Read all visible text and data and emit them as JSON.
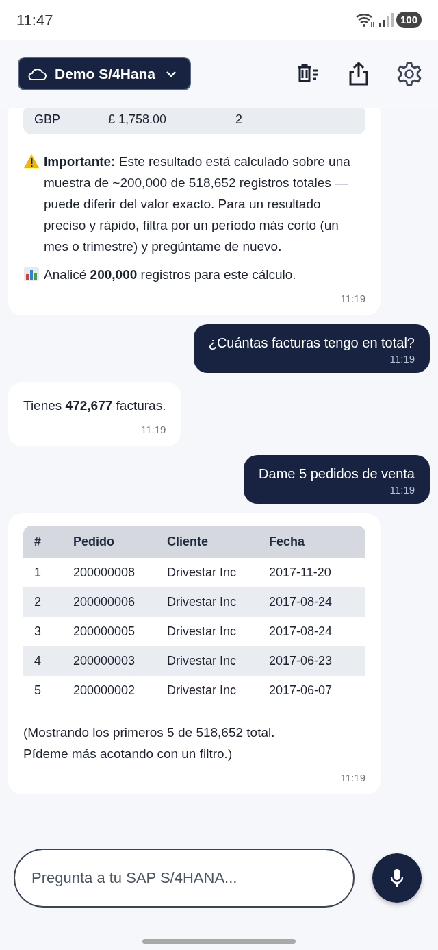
{
  "status_bar": {
    "time": "11:47",
    "battery": "100"
  },
  "header": {
    "workspace": "Demo S/4Hana"
  },
  "messages": [
    {
      "kind": "bot",
      "table_tail": [
        [
          "GBP",
          "£ 1,758.00",
          "2"
        ]
      ],
      "paragraphs": [
        {
          "kind": "warning",
          "text": "**Importante:** Este resultado está calculado sobre una muestra de ~200,000 de 518,652 registros totales — puede diferir del valor exacto. Para un resultado preciso y rápido, filtra por un período más corto (un mes o trimestre) y pregúntame de nuevo."
        },
        {
          "kind": "stats",
          "text": "Analicé **200,000** registros para este cálculo."
        }
      ],
      "time": "11:19"
    },
    {
      "kind": "user",
      "text": "¿Cuántas facturas tengo en total?",
      "time": "11:19"
    },
    {
      "kind": "bot",
      "paragraphs": [
        {
          "kind": "plain",
          "text": "Tienes **472,677** facturas."
        }
      ],
      "time": "11:19"
    },
    {
      "kind": "user",
      "text": "Dame 5 pedidos de venta",
      "time": "11:19"
    },
    {
      "kind": "bot",
      "table": {
        "columns": [
          "#",
          "Pedido",
          "Cliente",
          "Fecha"
        ],
        "rows": [
          [
            "1",
            "200000008",
            "Drivestar Inc",
            "2017-11-20"
          ],
          [
            "2",
            "200000006",
            "Drivestar Inc",
            "2017-08-24"
          ],
          [
            "3",
            "200000005",
            "Drivestar Inc",
            "2017-08-24"
          ],
          [
            "4",
            "200000003",
            "Drivestar Inc",
            "2017-06-23"
          ],
          [
            "5",
            "200000002",
            "Drivestar Inc",
            "2017-06-07"
          ]
        ]
      },
      "paragraphs": [
        {
          "kind": "plain",
          "text": "(Mostrando los primeros 5 de 518,652 total.\nPídeme más acotando con un filtro.)"
        }
      ],
      "time": "11:19"
    }
  ],
  "composer": {
    "placeholder": "Pregunta a tu SAP S/4HANA..."
  }
}
